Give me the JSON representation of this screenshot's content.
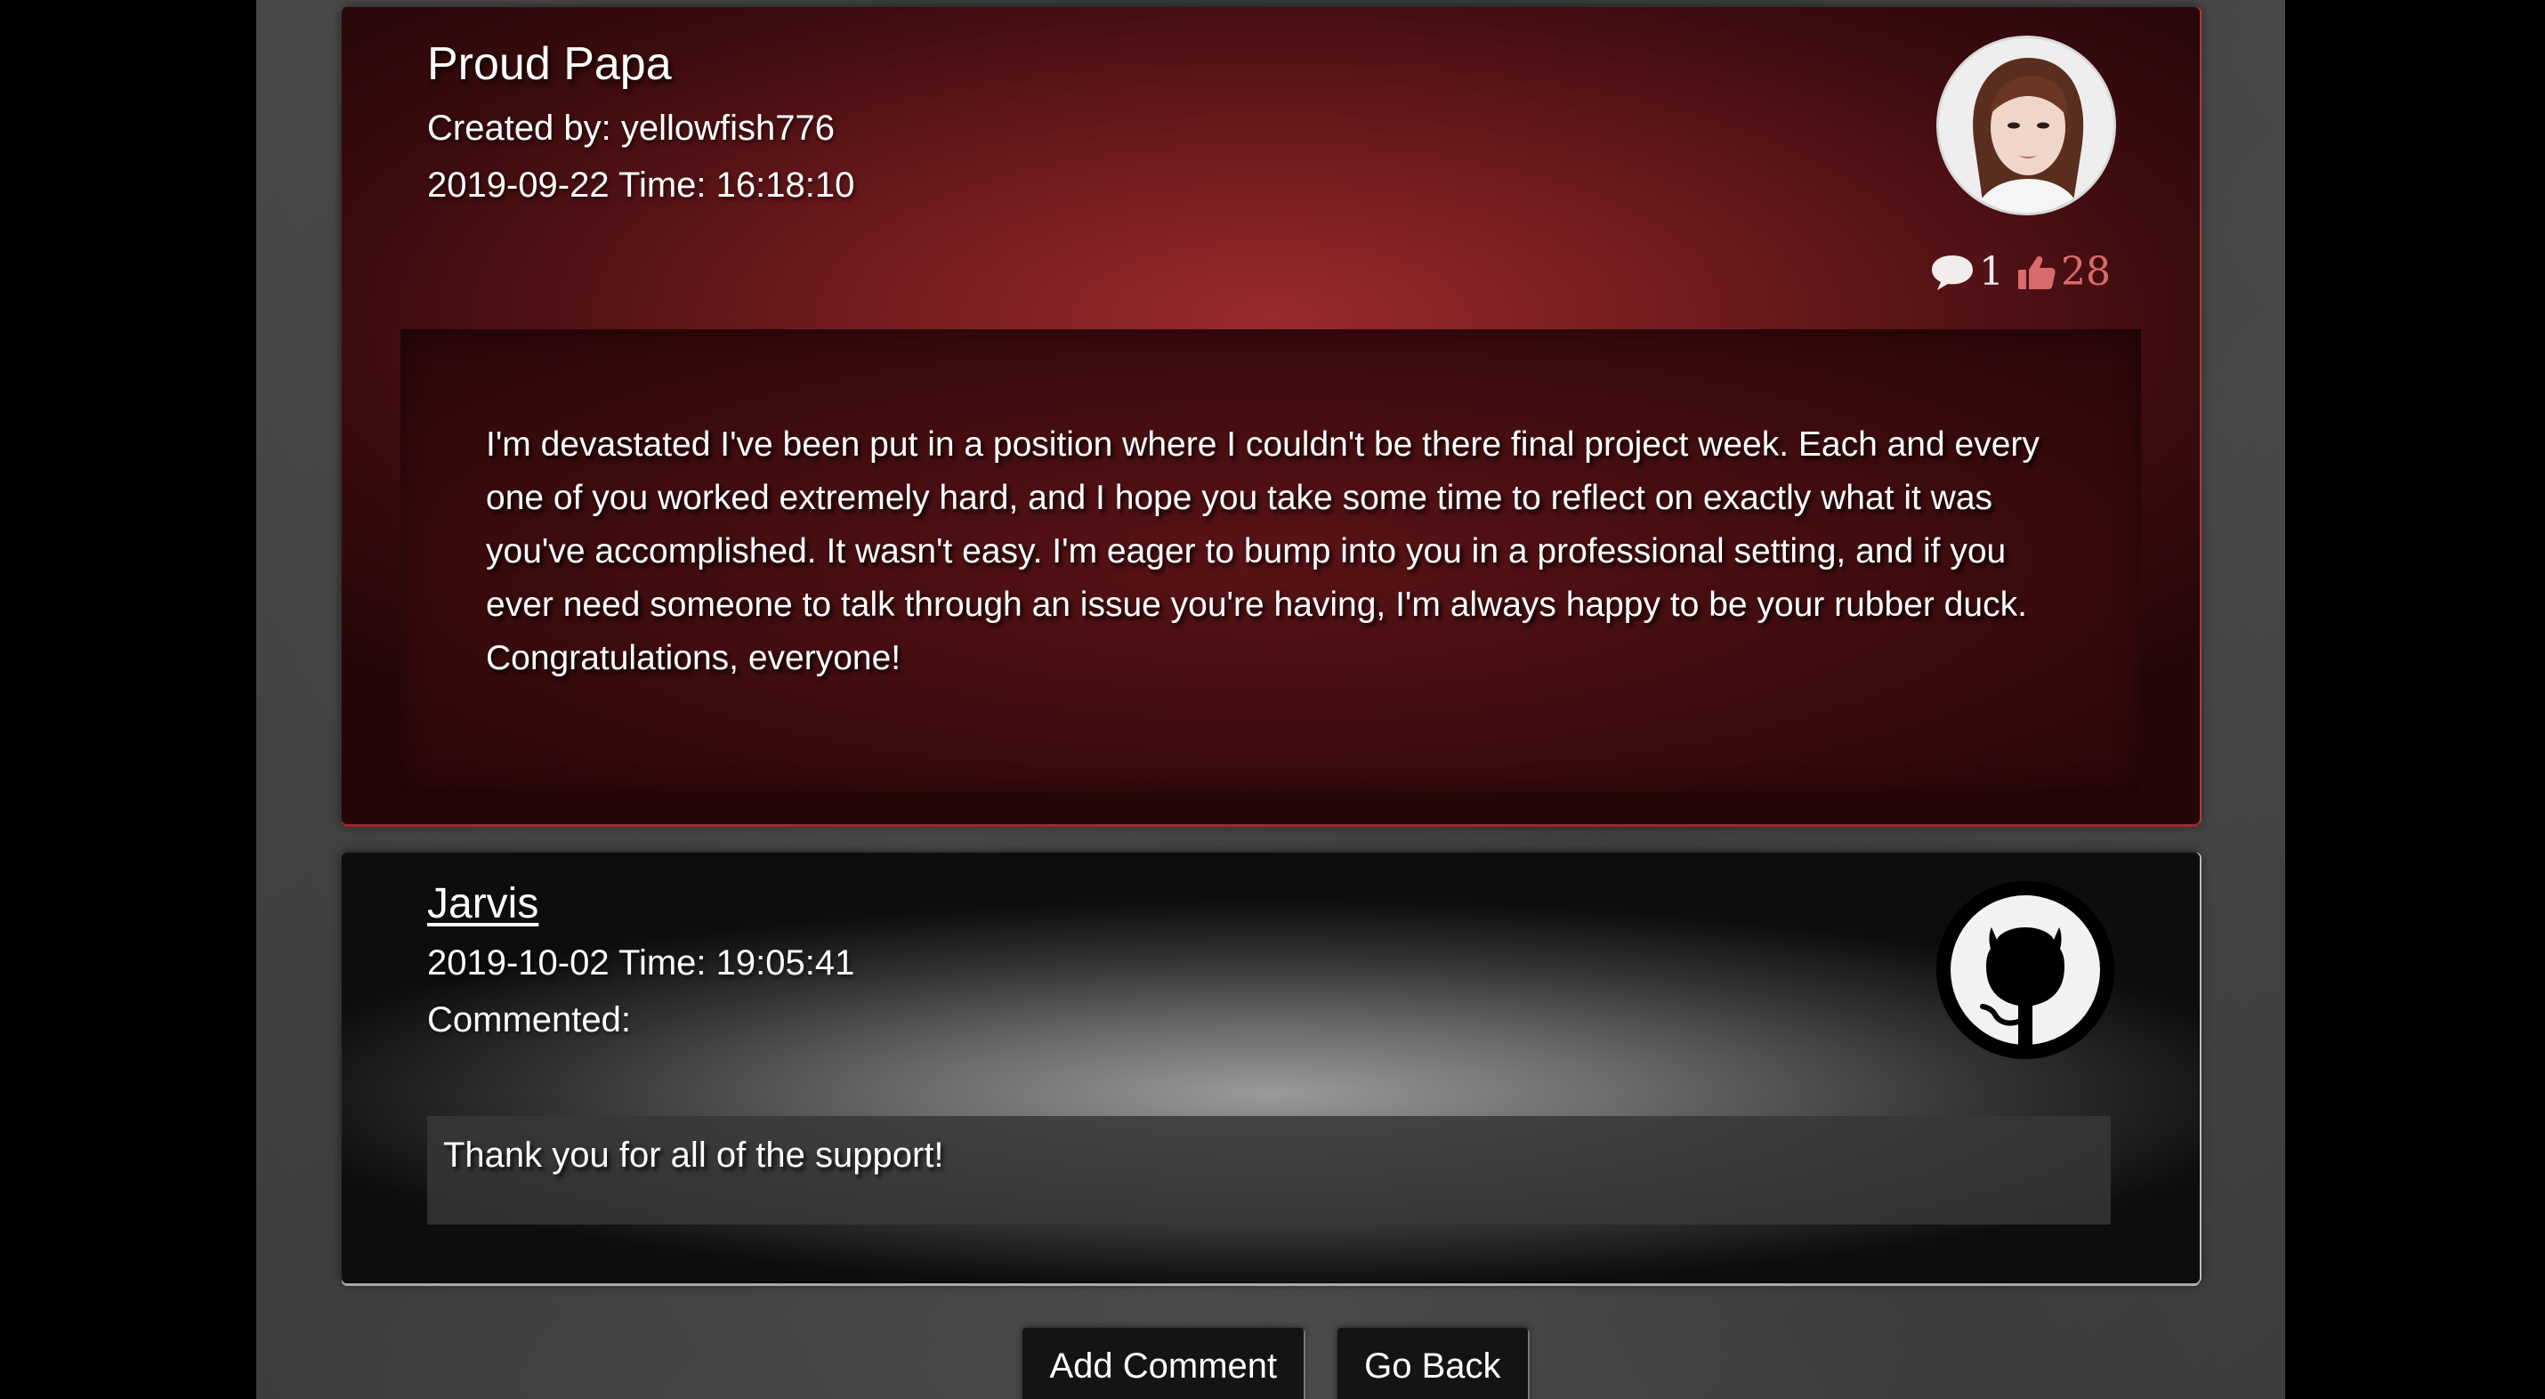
{
  "post": {
    "title": "Proud Papa",
    "created_by": "Created by: yellowfish776",
    "datetime": "2019-09-22 Time: 16:18:10",
    "comment_count": "1",
    "like_count": "28",
    "body": "I'm devastated I've been put in a position where I couldn't be there final project week. Each and every one of you worked extremely hard, and I hope you take some time to reflect on exactly what it was you've accomplished. It wasn't easy. I'm eager to bump into you in a professional setting, and if you ever need someone to talk through an issue you're having, I'm always happy to be your rubber duck. Congratulations, everyone!",
    "avatar_icon": "user-photo-avatar",
    "comment_icon": "speech-bubble-icon",
    "like_icon": "thumbs-up-icon",
    "like_color": "#d96b6d"
  },
  "comment": {
    "author": "Jarvis",
    "datetime": "2019-10-02 Time: 19:05:41",
    "label": "Commented:",
    "body": "Thank you for all of the support!",
    "avatar_icon": "github-icon"
  },
  "actions": {
    "add_comment_label": "Add Comment",
    "go_back_label": "Go Back"
  },
  "colors": {
    "post_accent": "#9a2a2c",
    "background": "#3f3f3f",
    "outer": "#000000"
  }
}
